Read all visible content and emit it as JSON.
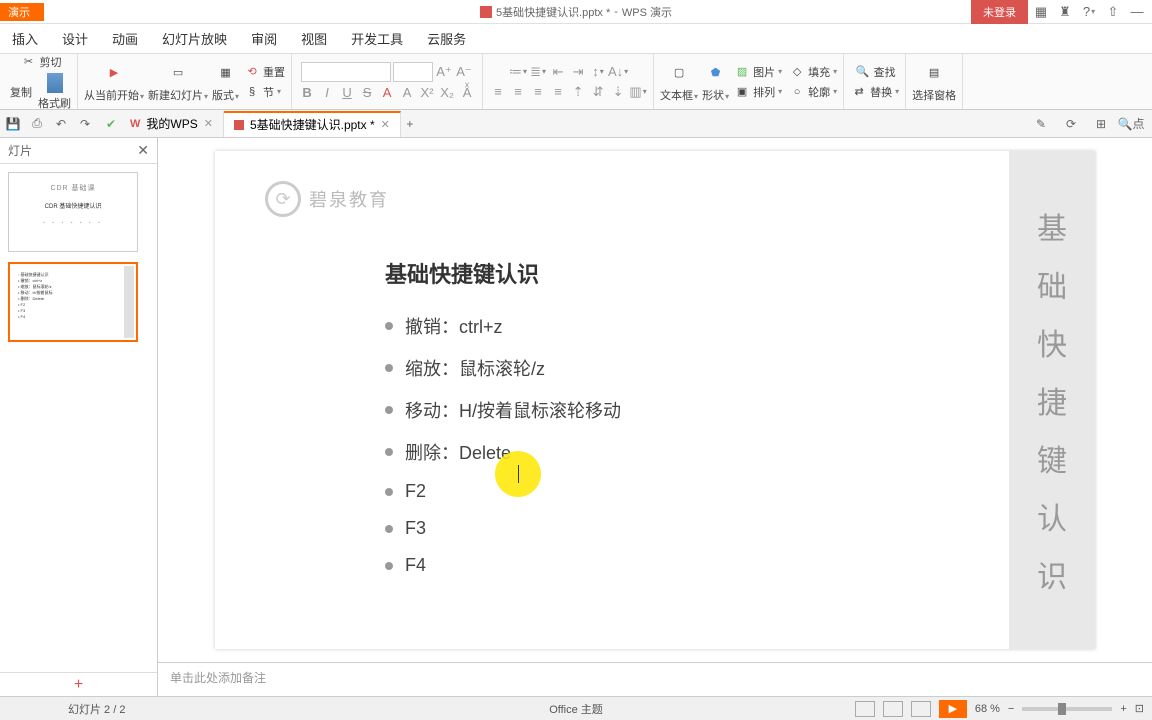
{
  "title": {
    "app_mode": "演示",
    "doc_name": "5基础快捷键认识.pptx *",
    "app_name": "WPS 演示",
    "login": "未登录"
  },
  "menu": {
    "insert": "插入",
    "design": "设计",
    "animation": "动画",
    "slideshow": "幻灯片放映",
    "review": "审阅",
    "view": "视图",
    "dev": "开发工具",
    "cloud": "云服务"
  },
  "ribbon": {
    "cut": "剪切",
    "copy": "复制",
    "format_painter": "格式刷",
    "from_current": "从当前开始",
    "new_slide": "新建幻灯片",
    "layout": "版式",
    "section": "节",
    "reset": "重置",
    "textbox": "文本框",
    "shape": "形状",
    "arrange": "排列",
    "outline": "轮廓",
    "picture": "图片",
    "fill": "填充",
    "find": "查找",
    "replace": "替换",
    "select_pane": "选择窗格"
  },
  "tabs": {
    "my_wps": "我的WPS",
    "doc": "5基础快捷键认识.pptx *"
  },
  "qsearch": "点",
  "sidepanel": {
    "title": "灯片",
    "thumb1_title": "CDR 基础课",
    "thumb1_sub": "CDR 基础快捷键认识"
  },
  "slide": {
    "brand": "碧泉教育",
    "title": "基础快捷键认识",
    "bullets": [
      "撤销：ctrl+z",
      "缩放：鼠标滚轮/z",
      "移动：H/按着鼠标滚轮移动",
      "删除：Delete",
      "F2",
      "F3",
      "F4"
    ],
    "side_chars": [
      "基",
      "础",
      "快",
      "捷",
      "键",
      "认",
      "识"
    ]
  },
  "notes": {
    "placeholder": "单击此处添加备注"
  },
  "status": {
    "slide_count": "幻灯片 2 / 2",
    "theme": "Office 主题",
    "zoom": "68 %"
  }
}
